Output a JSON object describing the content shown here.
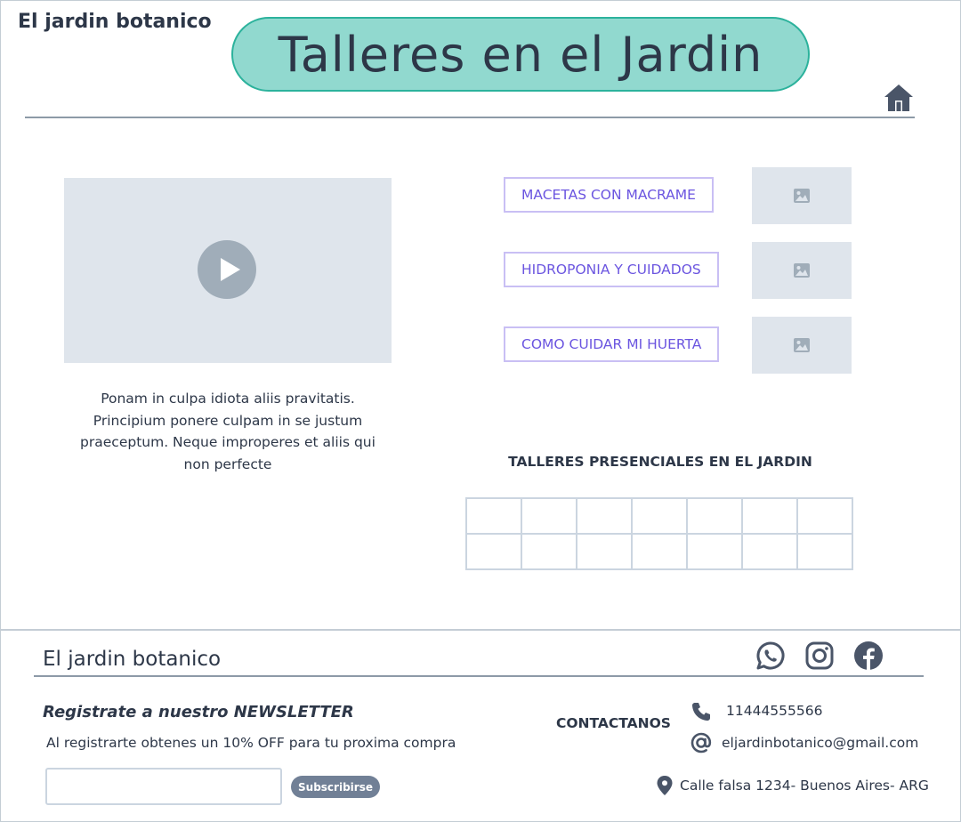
{
  "header": {
    "brand": "El jardin botanico",
    "title": "Talleres en el Jardin",
    "home_icon": "home-icon"
  },
  "video": {
    "play_icon": "play-icon",
    "description": "Ponam in culpa idiota aliis pravitatis. Principium ponere culpam in se justum praeceptum. Neque improperes et aliis qui non perfecte"
  },
  "workshops": [
    {
      "label": "MACETAS CON MACRAME",
      "image_icon": "image-icon"
    },
    {
      "label": "HIDROPONIA Y CUIDADOS",
      "image_icon": "image-icon"
    },
    {
      "label": "COMO CUIDAR MI HUERTA",
      "image_icon": "image-icon"
    }
  ],
  "schedule": {
    "title": "TALLERES PRESENCIALES EN EL JARDIN",
    "rows": 2,
    "columns": 7
  },
  "footer": {
    "brand": "El jardin botanico",
    "social_icons": [
      "whatsapp-icon",
      "instagram-icon",
      "facebook-icon"
    ],
    "newsletter": {
      "title": "Registrate a nuestro NEWSLETTER",
      "subtitle": "Al registrarte obtenes un 10% OFF para tu proxima compra",
      "input_value": "",
      "button_label": "Subscribirse"
    },
    "contact": {
      "title": "CONTACTANOS",
      "phone": "11444555566",
      "email": "eljardinbotanico@gmail.com",
      "address": "Calle falsa 1234- Buenos Aires- ARG"
    }
  },
  "colors": {
    "title_pill_bg": "#91d9cf",
    "title_pill_border": "#2cb29c",
    "accent_purple": "#6b55e0",
    "placeholder_gray": "#dfe5ec",
    "text_dark": "#2d3748"
  }
}
